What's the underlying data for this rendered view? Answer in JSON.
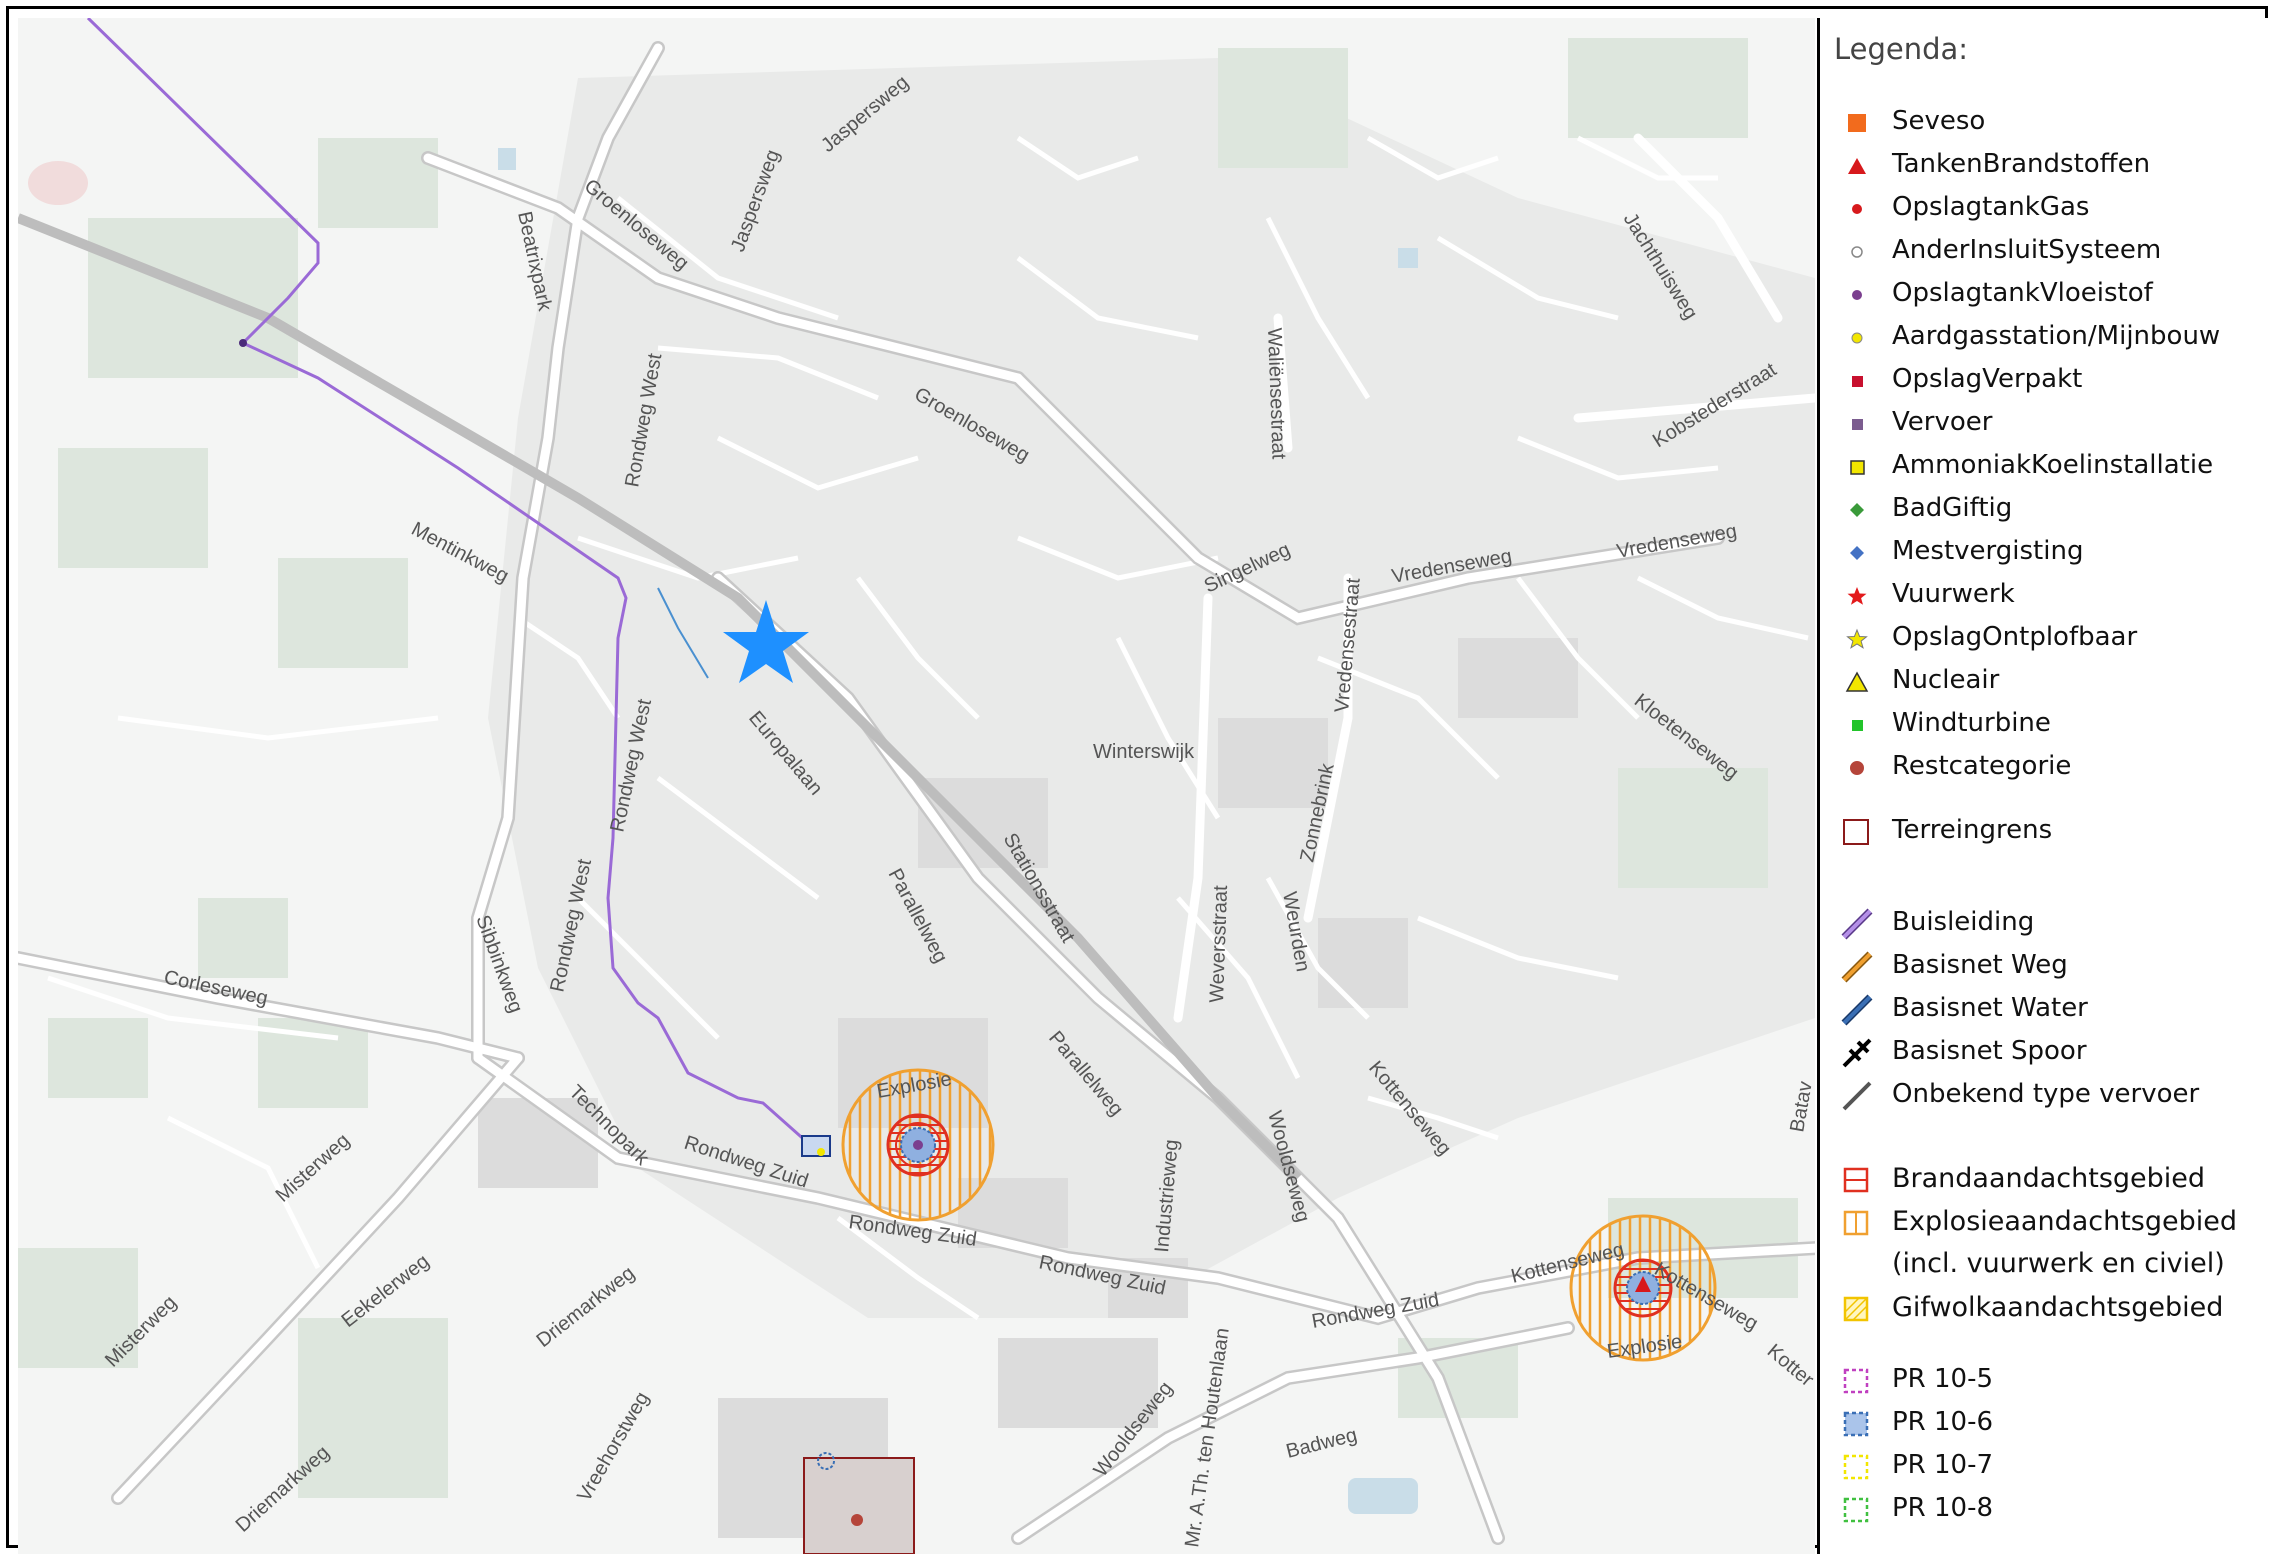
{
  "legend": {
    "title": "Legenda:",
    "items": [
      {
        "label": "Seveso",
        "icon": "orange-square-icon",
        "color": "#f26b1d"
      },
      {
        "label": "TankenBrandstoffen",
        "icon": "red-triangle-icon",
        "color": "#d7191c"
      },
      {
        "label": "OpslagtankGas",
        "icon": "red-dot-icon",
        "color": "#d7191c"
      },
      {
        "label": "AnderInsluitSysteem",
        "icon": "white-dot-icon",
        "color": "#ffffff"
      },
      {
        "label": "OpslagtankVloeistof",
        "icon": "purple-dot-icon",
        "color": "#7b3f8f"
      },
      {
        "label": "Aardgasstation/Mijnbouw",
        "icon": "yellow-dot-icon",
        "color": "#f2e600"
      },
      {
        "label": "OpslagVerpakt",
        "icon": "red-small-square-icon",
        "color": "#c8102e"
      },
      {
        "label": "Vervoer",
        "icon": "purple-small-square-icon",
        "color": "#7b5c8f"
      },
      {
        "label": "AmmoniakKoelinstallatie",
        "icon": "yellow-small-square-icon",
        "color": "#f2e600"
      },
      {
        "label": "BadGiftig",
        "icon": "green-diamond-icon",
        "color": "#3a9a3a"
      },
      {
        "label": "Mestvergisting",
        "icon": "blue-diamond-icon",
        "color": "#4472c4"
      },
      {
        "label": "Vuurwerk",
        "icon": "red-star-icon",
        "color": "#e31a1c"
      },
      {
        "label": "OpslagOntplofbaar",
        "icon": "yellow-star-icon",
        "color": "#f2e600"
      },
      {
        "label": "Nucleair",
        "icon": "yellow-triangle-icon",
        "color": "#f2e600"
      },
      {
        "label": "Windturbine",
        "icon": "green-small-square-icon",
        "color": "#22c42a"
      },
      {
        "label": "Restcategorie",
        "icon": "brown-dot-icon",
        "color": "#b5453a"
      },
      {
        "label": "Terreingrens",
        "icon": "outline-square-icon",
        "color": "#8b1a1a"
      },
      {
        "label": "Buisleiding",
        "icon": "purple-line-icon",
        "color": "#9a6ad6"
      },
      {
        "label": "Basisnet Weg",
        "icon": "orange-line-icon",
        "color": "#f0a030"
      },
      {
        "label": "Basisnet Water",
        "icon": "blue-line-icon",
        "color": "#3a6fb5"
      },
      {
        "label": "Basisnet Spoor",
        "icon": "rail-line-icon",
        "color": "#000000"
      },
      {
        "label": "Onbekend type vervoer",
        "icon": "grey-line-icon",
        "color": "#555555"
      },
      {
        "label": "Brandaandachtsgebied",
        "icon": "red-hatched-square-icon",
        "color": "#e03020"
      },
      {
        "label": "Explosieaandachtsgebied",
        "icon": "orange-hatched-square-icon",
        "color": "#f0a030"
      },
      {
        "label": "(incl. vuurwerk en civiel)",
        "icon": "",
        "color": ""
      },
      {
        "label": "Gifwolkaandachtsgebied",
        "icon": "yellow-hatched-square-icon",
        "color": "#f2d040"
      },
      {
        "label": "PR 10-5",
        "icon": "magenta-dashed-square-icon",
        "color": "#c040c0"
      },
      {
        "label": "PR 10-6",
        "icon": "blue-dashed-square-icon",
        "color": "#3a6fb5"
      },
      {
        "label": "PR 10-7",
        "icon": "yellow-dashed-square-icon",
        "color": "#f2e600"
      },
      {
        "label": "PR 10-8",
        "icon": "green-dashed-square-icon",
        "color": "#40c040"
      }
    ]
  },
  "map": {
    "marker_icon": "blue-star-icon",
    "marker_color": "#1e90ff",
    "explosion_label": "Explosie",
    "street_labels": {
      "jaspersweg1": "Jaspersweg",
      "jaspersweg2": "Jaspersweg",
      "groenloseweg1": "Groenloseweg",
      "groenloseweg2": "Groenloseweg",
      "beatrixpark": "Beatrixpark",
      "rondwegwest1": "Rondweg West",
      "rondwegwest2": "Rondweg West",
      "rondwegwest3": "Rondweg West",
      "mentinkweg": "Mentinkweg",
      "europalaan": "Europalaan",
      "parallelweg1": "Parallelweg",
      "parallelweg2": "Parallelweg",
      "parallelweg3": "Parallelweg",
      "stationsstraat": "Stationsstraat",
      "winterswijk": "Winterswijk",
      "walienstraat": "Waliënsestraat",
      "singelweg": "Singelweg",
      "vredenseweg1": "Vredenseweg",
      "vredenseweg2": "Vredenseweg",
      "vredensestraat": "Vredensestraat",
      "kobstederstraat": "Kobstederstraat",
      "jachthuisweg": "Jachthuisweg",
      "kloetenseweg": "Kloetenseweg",
      "zonnebrink": "Zonnebrink",
      "weversstraat": "Weversstraat",
      "weurden": "Weurden",
      "sibbinkweg": "Sibbinkweg",
      "corleseweg": "Corleseweg",
      "technopark": "Technopark",
      "rondwegzuid1": "Rondweg Zuid",
      "rondwegzuid2": "Rondweg Zuid",
      "rondwegzuid3": "Rondweg Zuid",
      "rondwegzuid4": "Rondweg Zuid",
      "misterweg1": "Misterweg",
      "misterweg2": "Misterweg",
      "eekelerweg": "Eekelerweg",
      "driemarkweg1": "Driemarkweg",
      "driemarkweg2": "Driemarkweg",
      "vreehorstweg": "Vreehorstweg",
      "industrieweg": "Industrieweg",
      "wooldseweg1": "Wooldseweg",
      "wooldseweg2": "Wooldseweg",
      "houtenlaan": "Mr. A.Th. ten Houtenlaan",
      "badweg": "Badweg",
      "kottenseweg1": "Kottenseweg",
      "kottenseweg2": "Kottenseweg",
      "kottenseweg3": "Kottenseweg",
      "kotter": "Kotter",
      "batav": "Batav"
    }
  }
}
